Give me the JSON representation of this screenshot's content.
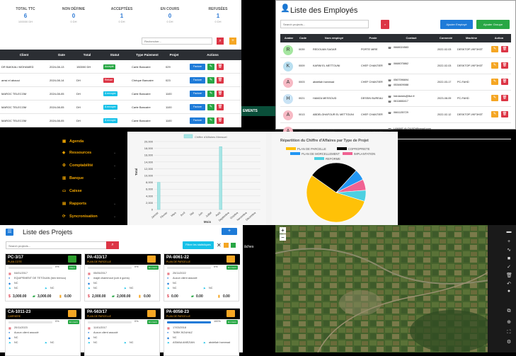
{
  "invoices": {
    "kpis": [
      {
        "title": "TOTAL TTC",
        "value": "6",
        "sub": "100000 DH"
      },
      {
        "title": "NON DÉFINIE",
        "value": "0",
        "sub": "0 DH"
      },
      {
        "title": "ACCEPTÉES",
        "value": "1",
        "sub": "0 DH"
      },
      {
        "title": "EN COURS",
        "value": "0",
        "sub": "0 DH"
      },
      {
        "title": "REFUSÉES",
        "value": "1",
        "sub": "0 DH"
      }
    ],
    "search_placeholder": "Rechercher...",
    "columns": [
      "Client",
      "Date",
      "Total",
      "Statut",
      "Type Paiement",
      "Projet",
      "Actions"
    ],
    "rows": [
      {
        "client": "DR BAKKALI MOHAMED",
        "date": "2024-08-13",
        "total": "150000 DH",
        "status": "Accepté",
        "status_color": "#28a745",
        "payment": "Carte Bancaire",
        "project": "029"
      },
      {
        "client": "amsi el abaoui",
        "date": "2024-08-14",
        "total": "DH",
        "status": "Refusé",
        "status_color": "#dc3545",
        "payment": "Chèque Bancaire",
        "project": "023"
      },
      {
        "client": "MAROC TELECOM",
        "date": "2024-08-05",
        "total": "DH",
        "status": "À envoyer",
        "status_color": "#17c1e8",
        "payment": "Carte Bancaire",
        "project": "1100"
      },
      {
        "client": "MAROC TELECOM",
        "date": "2024-08-05",
        "total": "DH",
        "status": "À envoyer",
        "status_color": "#17c1e8",
        "payment": "Carte Bancaire",
        "project": "1100"
      },
      {
        "client": "MAROC TELECOM",
        "date": "2024-08-05",
        "total": "DH",
        "status": "À envoyer",
        "status_color": "#17c1e8",
        "payment": "Carte Bancaire",
        "project": "1100"
      }
    ],
    "facture_label": "Facture"
  },
  "employees": {
    "title": "Liste des Employés",
    "search_placeholder": "Search projects...",
    "add_employee": "Ajouter Employé",
    "add_group": "Ajouter Groupe",
    "columns": [
      "Avatar",
      "Code",
      "Nom employé",
      "Poste",
      "Contact",
      "Connecté",
      "Machine",
      "Action"
    ],
    "rows": [
      {
        "avatar": "R",
        "avatar_color": "#a5e6a0",
        "code": "0039",
        "name": "REDOUAN SAGAR",
        "post": "PORTE MIRE",
        "contact1": "0668024583",
        "contact2": "",
        "date": "2022-02-03",
        "machine": "DESKTOP-VKF3H3T"
      },
      {
        "avatar": "K",
        "avatar_color": "#b9dff0",
        "code": "0009",
        "name": "KARIM EL METTOUNI",
        "post": "CHEF CHANTIER",
        "contact1": "0668075862",
        "contact2": "",
        "date": "2022-02-03",
        "machine": "DESKTOP-VKF3H3T"
      },
      {
        "avatar": "A",
        "avatar_color": "#f7b9c4",
        "code": "0003",
        "name": "abdellah hammad",
        "post": "CHEF CHANTIER",
        "contact1": "0567096694",
        "contact2": "0534609088",
        "date": "2022-03-17",
        "machine": "PC-FAHD"
      },
      {
        "avatar": "H",
        "avatar_color": "#c9e3f5",
        "code": "0021",
        "name": "HAMZA MESSOUD",
        "post": "DESSIN BUREAU",
        "contact1": "hdrdames@live.fr",
        "contact2": "0611666417",
        "date": "2023-08-09",
        "machine": "PC-FAHD"
      },
      {
        "avatar": "A",
        "avatar_color": "#f7b9c4",
        "code": "0013",
        "name": "ABDELGHAFOUR EL METTOUNI",
        "post": "CHEF CHANTIER",
        "contact1": "0661135729",
        "contact2": "",
        "date": "2022-02-12",
        "machine": "DESKTOP-VKF3H3T"
      },
      {
        "avatar": "A",
        "avatar_color": "#f7b9c4",
        "code": "0023",
        "name": "LAMIAE ALOUADI",
        "post": "DESSIN BUREAU",
        "contact1": "LAMIAE.ALOUADI@gmail.com",
        "contact2": "",
        "date": "",
        "machine": ""
      }
    ]
  },
  "menu": {
    "items": [
      "Agenda",
      "Ressources",
      "Comptabilité",
      "Banque",
      "Caisse",
      "Rapports",
      "Syncronisation"
    ]
  },
  "partial_texts": {
    "paiements": "EMENTS",
    "taches": "âches"
  },
  "chart_data": [
    {
      "type": "bar",
      "title": "Chiffre d'Affaires Mensuel",
      "legend": "Chiffre d'Affaires Mensuel",
      "xlabel": "Mois",
      "ylabel": "Total",
      "categories": [
        "Janvier",
        "Février",
        "Mars",
        "Avril",
        "Mai",
        "Juin",
        "Juillet",
        "Août",
        "Septembre",
        "Octobre",
        "Novembre",
        "Décembre"
      ],
      "values": [
        8000,
        0,
        0,
        0,
        0,
        0,
        0,
        18500,
        0,
        0,
        0,
        0
      ],
      "ylim": [
        0,
        20000
      ],
      "yticks": [
        "0",
        "2,000",
        "4,000",
        "6,000",
        "8,000",
        "10,000",
        "12,000",
        "14,000",
        "16,000",
        "18,000",
        "20,000"
      ],
      "color": "#a8e6e6"
    },
    {
      "type": "pie",
      "title": "Répartition du Chiffre d'Affaires par Type de Projet",
      "series": [
        {
          "name": "PLAN DE PARCELLE",
          "value": 55,
          "color": "#ffc107"
        },
        {
          "name": "COPROPRIETE",
          "value": 27,
          "color": "#000000"
        },
        {
          "name": "PLAN DE MORCELLEMENT",
          "value": 6,
          "color": "#2196f3"
        },
        {
          "name": "IMPLANTATION",
          "value": 6,
          "color": "#f06292"
        },
        {
          "name": "REFORME",
          "value": 6,
          "color": "#4dd0e1"
        }
      ]
    }
  ],
  "projects": {
    "title": "Liste des Projets",
    "search_placeholder": "Search projects...",
    "filter_label": "Filtrer les statistiques",
    "cards": [
      {
        "code": "PC-3/17",
        "type": "PLAN COTE",
        "folder": "#2e9e2e",
        "pct": "0%",
        "badge": "Client",
        "badge_color": "#28a745",
        "date": "04/01/2017",
        "client": "EQUIPEMENT DE TETOUAN (ben brimou)",
        "city": "NC",
        "nc1": "NC",
        "nc2": "NC",
        "m1": "3,000.00",
        "m2": "3,000.00",
        "m3": "0.00"
      },
      {
        "code": "PA-433/17",
        "type": "PLAN DE PARCELLE",
        "folder": "#f5a623",
        "pct": "0%",
        "badge": "En cours",
        "badge_color": "#28a745",
        "date": "05/05/2017",
        "client": "majdi chammout (ccb d goms)",
        "city": "NC",
        "nc1": "NC",
        "nc2": "NC",
        "m1": "2,000.00",
        "m2": "2,000.00",
        "m3": "0.00"
      },
      {
        "code": "PA-8061-22",
        "type": "PLAN DE PARCELLE",
        "folder": "#f5a623",
        "pct": "0%",
        "badge": "En cours",
        "badge_color": "#28a745",
        "date": "25/11/2022",
        "client": "Aucun client associé",
        "city": "NC",
        "nc1": "NC",
        "nc2": "NC",
        "m1": "0.00",
        "m2": "0.00",
        "m3": "0.00"
      },
      {
        "code": "CA-1011-23",
        "type": "CARRIERE",
        "folder": "#f5a623",
        "pct": "0%",
        "badge": "En cours",
        "badge_color": "#28a745",
        "date": "20/11/2023",
        "client": "Aucun client associé",
        "city": "NC",
        "nc1": "NC",
        "nc2": "NC",
        "m1": "",
        "m2": "",
        "m3": ""
      },
      {
        "code": "PA-563/17",
        "type": "PLAN DE PARCELLE",
        "folder": "#f5a623",
        "pct": "0%",
        "badge": "En cours",
        "badge_color": "#28a745",
        "date": "11/01/2017",
        "client": "Aucun client associé",
        "city": "NC",
        "nc1": "NC",
        "nc2": "NC",
        "m1": "",
        "m2": "",
        "m3": ""
      },
      {
        "code": "PA-8058-23",
        "type": "PLAN DE PARCELLE",
        "folder": "#f5a623",
        "pct": "100%",
        "badge": "En cours",
        "badge_color": "#28a745",
        "date": "17/03/2018",
        "client": "TARIK BOUHAZ",
        "city": "NC",
        "nc1": "ASMAA AMEZIAN",
        "nc2": "abdellah hammad",
        "m1": "",
        "m2": "",
        "m3": ""
      }
    ]
  },
  "map": {
    "zoom_in": "+",
    "zoom_out": "−"
  }
}
